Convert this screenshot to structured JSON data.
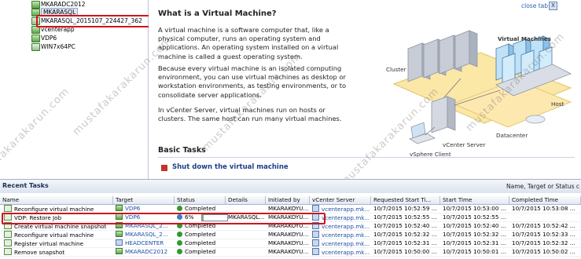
{
  "tree": {
    "items": [
      {
        "label": "MKARADC2012",
        "powered": true
      },
      {
        "label": "MKARASQL",
        "powered": true,
        "selected": true
      },
      {
        "label": "MKARASQL_2015107_224427_362",
        "powered": false
      },
      {
        "label": "vcenterapp",
        "powered": true
      },
      {
        "label": "VDP6",
        "powered": true
      },
      {
        "label": "WIN7x64PC",
        "powered": false
      }
    ]
  },
  "summary": {
    "title": "What is a Virtual Machine?",
    "close_tab": "close tab",
    "close_x": "X",
    "paragraphs": [
      "A virtual machine is a software computer that, like a physical computer, runs an operating system and applications. An operating system installed on a virtual machine is called a guest operating system.",
      "Because every virtual machine is an isolated computing environment, you can use virtual machines as desktop or workstation environments, as testing environments, or to consolidate server applications.",
      "In vCenter Server, virtual machines run on hosts or clusters. The same host can run many virtual machines."
    ],
    "basic_tasks": "Basic Tasks",
    "shutdown": "Shut down the virtual machine",
    "diagram": {
      "virtual_machines": "Virtual Machines",
      "cluster": "Cluster",
      "host": "Host",
      "datacenter": "Datacenter",
      "vcenter": "vCenter Server",
      "vsphere_client": "vSphere Client"
    }
  },
  "watermark": "mustafakarakarun.com",
  "recent_tasks": {
    "title": "Recent Tasks",
    "filter_label": "Name, Target or Status c",
    "columns": [
      "Name",
      "Target",
      "Status",
      "Details",
      "Initiated by",
      "vCenter Server",
      "Requested Start Ti...",
      "Start Time",
      "Completed Time"
    ],
    "rows": [
      {
        "name": "Reconfigure virtual machine",
        "target": "VDP6",
        "status": "Completed",
        "details": "",
        "initiated": "MKARAKOYU...",
        "vcenter": "vcenterapp.mk...",
        "requested": "10/7/2015 10:52:59 ...",
        "start": "10/7/2015 10:53:00 ...",
        "completed": "10/7/2015 10:53:08 ..."
      },
      {
        "name": "VDP: Restore Job",
        "target": "VDP6",
        "status": "6%",
        "progress": 0.06,
        "details": "MKARASQL...",
        "initiated": "MKARAKOYU...",
        "vcenter": "vcenterapp.mk...",
        "requested": "10/7/2015 10:52:55 ...",
        "start": "10/7/2015 10:52:55 ...",
        "completed": ""
      },
      {
        "name": "Create virtual machine snapshot",
        "target": "MKARASQL_2...",
        "status": "Completed",
        "details": "",
        "initiated": "MKARAKOYU...",
        "vcenter": "vcenterapp.mk...",
        "requested": "10/7/2015 10:52:40 ...",
        "start": "10/7/2015 10:52:40 ...",
        "completed": "10/7/2015 10:52:42 ..."
      },
      {
        "name": "Reconfigure virtual machine",
        "target": "MKARASQL_2...",
        "status": "Completed",
        "details": "",
        "initiated": "MKARAKOYU...",
        "vcenter": "vcenterapp.mk...",
        "requested": "10/7/2015 10:52:32 ...",
        "start": "10/7/2015 10:52:32 ...",
        "completed": "10/7/2015 10:52:33 ..."
      },
      {
        "name": "Register virtual machine",
        "target": "HEADCENTER",
        "status": "Completed",
        "details": "",
        "initiated": "MKARAKOYU...",
        "vcenter": "vcenterapp.mk...",
        "requested": "10/7/2015 10:52:31 ...",
        "start": "10/7/2015 10:52:31 ...",
        "completed": "10/7/2015 10:52:32 ..."
      },
      {
        "name": "Remove snapshot",
        "target": "MKARADC2012",
        "status": "Completed",
        "details": "",
        "initiated": "MKARAKOYU...",
        "vcenter": "vcenterapp.mk...",
        "requested": "10/7/2015 10:50:00 ...",
        "start": "10/7/2015 10:50:01 ...",
        "completed": "10/7/2015 10:50:02 ..."
      }
    ]
  },
  "colors": {
    "accent": "#1e4fa3",
    "highlight": "#d0141e",
    "ok": "#2f9a2f"
  }
}
